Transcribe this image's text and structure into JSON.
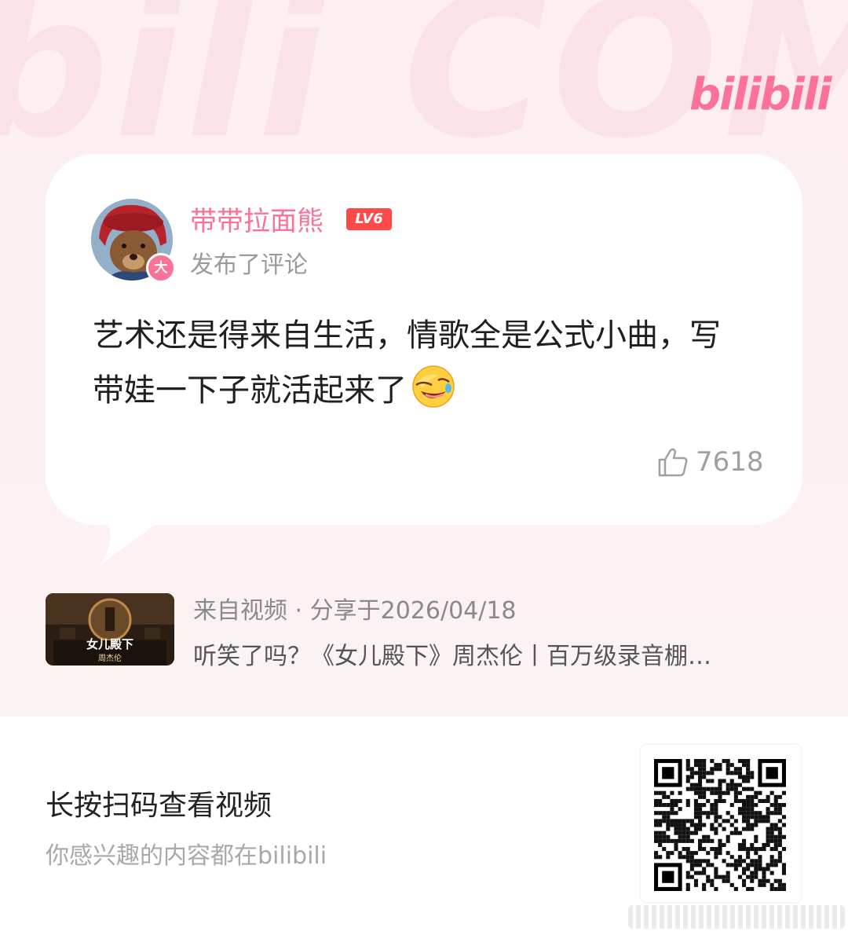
{
  "brand": {
    "background_word": "bili COMMENT",
    "logo_text": "bilibili",
    "accent": "#fb7299"
  },
  "comment": {
    "username": "带带拉面熊",
    "level": "LV6",
    "avatar_badge": "大",
    "action": "发布了评论",
    "text": "艺术还是得来自生活，情歌全是公式小曲，写带娃一下子就活起来了",
    "emoji": "laughing-face-emoji",
    "likes": "7618"
  },
  "source": {
    "meta": "来自视频 · 分享于2026/04/18",
    "video_title": "听笑了吗？《女儿殿下》周杰伦丨百万级录音棚…",
    "thumbnail_title": "女儿殿下",
    "thumbnail_subtitle": "周杰伦"
  },
  "footer": {
    "cta_title": "长按扫码查看视频",
    "cta_subtitle": "你感兴趣的内容都在bilibili",
    "qr_icon": "qr-code-icon"
  }
}
